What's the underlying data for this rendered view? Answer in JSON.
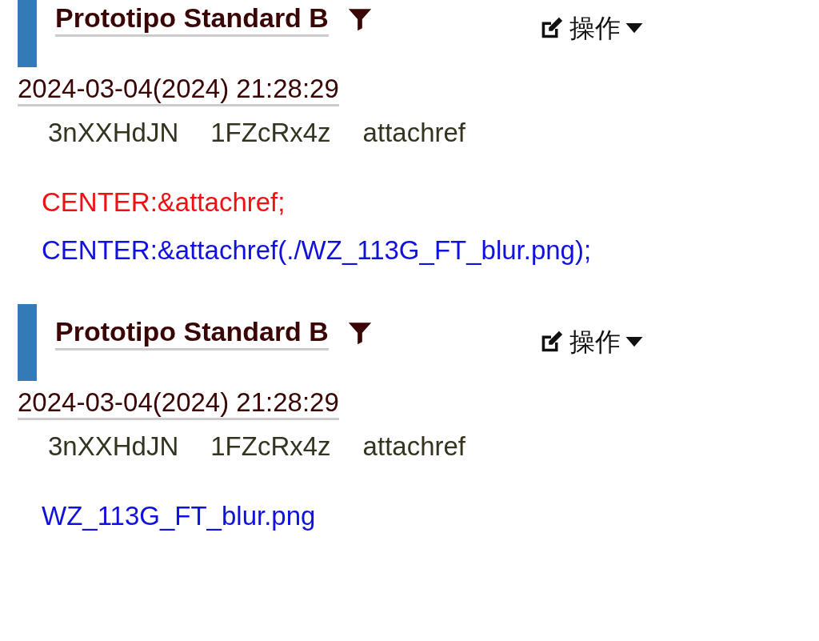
{
  "entries": [
    {
      "title": "Prototipo Standard B",
      "action": "操作",
      "date": "2024-03-04(2024) 21:28:29",
      "tags": [
        "3nXXHdJN",
        "1FZcRx4z",
        "attachref"
      ],
      "lines": [
        {
          "kind": "error",
          "text": "CENTER:&attachref;"
        },
        {
          "kind": "link",
          "text": "CENTER:&attachref(./WZ_113G_FT_blur.png);"
        }
      ]
    },
    {
      "title": "Prototipo Standard B",
      "action": "操作",
      "date": "2024-03-04(2024) 21:28:29",
      "tags": [
        "3nXXHdJN",
        "1FZcRx4z",
        "attachref"
      ],
      "lines": [
        {
          "kind": "link",
          "text": "WZ_113G_FT_blur.png"
        }
      ]
    }
  ]
}
